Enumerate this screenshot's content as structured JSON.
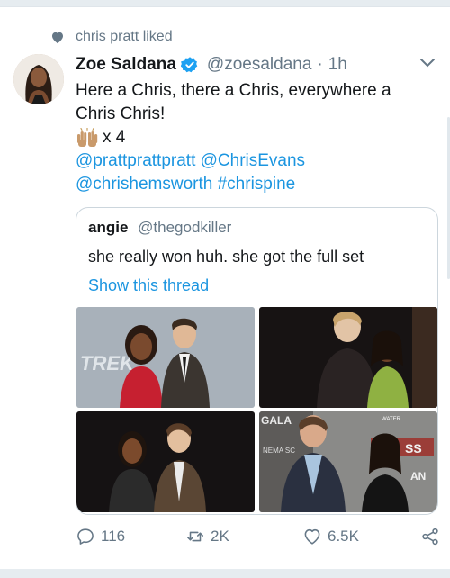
{
  "social_context": {
    "text": "chris pratt liked",
    "icon": "heart-icon"
  },
  "tweet": {
    "display_name": "Zoe Saldana",
    "handle": "@zoesaldana",
    "separator": "·",
    "time": "1h",
    "verified": true,
    "text_line": "Here a Chris, there a Chris, everywhere a Chris Chris!",
    "emoji": "raising-hands-emoji",
    "count_text": "x 4",
    "mentions_line1": "@prattprattpratt @ChrisEvans",
    "mentions_line2": "@chrishemsworth #chrispine"
  },
  "quoted": {
    "display_name": "angie",
    "handle": "@thegodkiller",
    "text": "she really won huh. she got the full set",
    "show_thread": "Show this thread",
    "photos": [
      "photo-star-trek-premiere",
      "photo-event-backdrop",
      "photo-dark-event",
      "photo-cinema-backdrop"
    ],
    "photo_text": {
      "star_trek": "TREK",
      "cinema": "NEMA SC",
      "gala": "GALA",
      "water": "WATER",
      "ss": "SS",
      "an": "AN"
    }
  },
  "actions": {
    "reply_count": "116",
    "retweet_count": "2K",
    "like_count": "6.5K"
  },
  "colors": {
    "link": "#1b95e0",
    "muted": "#657786",
    "verified": "#1da1f2",
    "border": "#ccd6dd"
  }
}
